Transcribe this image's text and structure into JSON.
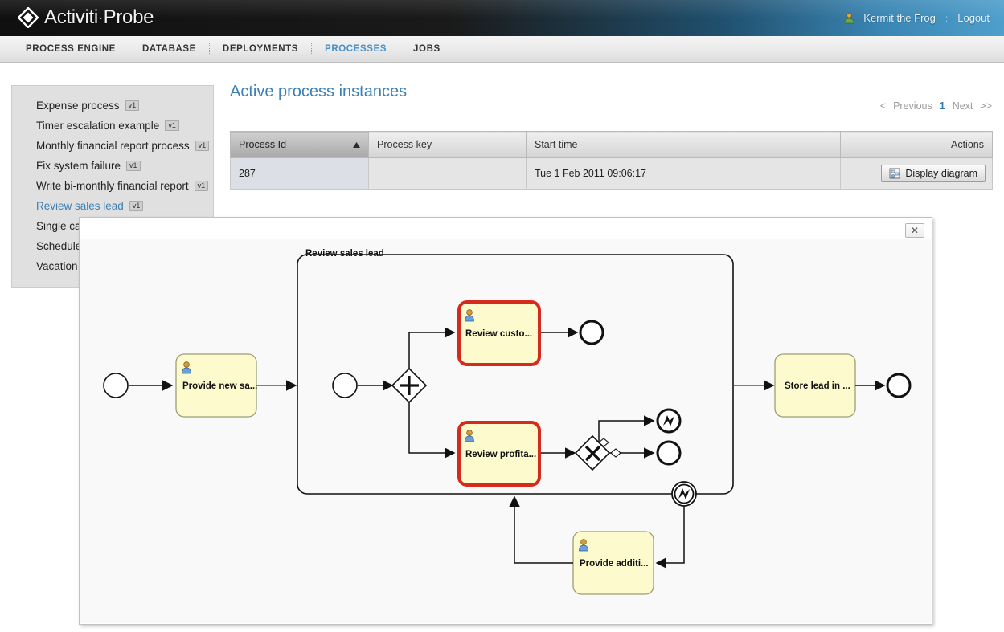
{
  "header": {
    "brand_name": "Activiti",
    "brand_sep": "·",
    "brand_name2": "Probe",
    "user_name": "Kermit the Frog",
    "logout_label": "Logout",
    "divider": ":",
    "user_icon": "user-icon",
    "logo_icon": "diamond-logo-icon"
  },
  "nav": {
    "items": [
      {
        "label": "PROCESS ENGINE",
        "active": false
      },
      {
        "label": "DATABASE",
        "active": false
      },
      {
        "label": "DEPLOYMENTS",
        "active": false
      },
      {
        "label": "PROCESSES",
        "active": true
      },
      {
        "label": "JOBS",
        "active": false
      }
    ]
  },
  "sidebar": {
    "items": [
      {
        "label": "Expense process",
        "version": "v1",
        "selected": false
      },
      {
        "label": "Timer escalation example",
        "version": "v1",
        "selected": false
      },
      {
        "label": "Monthly financial report process",
        "version": "v1",
        "selected": false
      },
      {
        "label": "Fix system failure",
        "version": "v1",
        "selected": false
      },
      {
        "label": "Write bi-monthly financial report",
        "version": "v1",
        "selected": false
      },
      {
        "label": "Review sales lead",
        "version": "v1",
        "selected": true
      },
      {
        "label": "Single ca",
        "version": "",
        "selected": false
      },
      {
        "label": "Schedule",
        "version": "",
        "selected": false
      },
      {
        "label": "Vacation",
        "version": "",
        "selected": false
      }
    ]
  },
  "main": {
    "title": "Active process instances",
    "pager": {
      "prev_arrow": "<",
      "prev_label": "Previous",
      "current_page": "1",
      "next_label": "Next",
      "next_arrow": ">>"
    },
    "table": {
      "columns": [
        {
          "label": "Process Id",
          "sorted": true,
          "sort_dir": "asc"
        },
        {
          "label": "Process key",
          "sorted": false,
          "sort_dir": ""
        },
        {
          "label": "Start time",
          "sorted": false,
          "sort_dir": ""
        },
        {
          "label": "",
          "sorted": false,
          "sort_dir": ""
        },
        {
          "label": "Actions",
          "sorted": false,
          "sort_dir": ""
        }
      ],
      "rows": [
        {
          "process_id": "287",
          "process_key": "",
          "start_time": "Tue 1 Feb 2011 09:06:17",
          "action_label": "Display diagram",
          "action_icon": "diagram-icon"
        }
      ]
    }
  },
  "modal": {
    "close_label": "✕",
    "close_icon": "close-icon",
    "diagram": {
      "subprocess_label": "Review sales lead",
      "nodes": [
        {
          "id": "start",
          "type": "start-event",
          "label": ""
        },
        {
          "id": "provide_new_sales_lead",
          "type": "user-task",
          "label": "Provide new sa...",
          "active": false
        },
        {
          "id": "sub_start",
          "type": "start-event",
          "label": ""
        },
        {
          "id": "parallel_gateway",
          "type": "parallel-gateway",
          "label": ""
        },
        {
          "id": "review_customer_rating",
          "type": "user-task",
          "label": "Review custo...",
          "active": true
        },
        {
          "id": "review_customer_end",
          "type": "end-event",
          "label": ""
        },
        {
          "id": "review_profitability",
          "type": "user-task",
          "label": "Review profita...",
          "active": true
        },
        {
          "id": "exclusive_gateway",
          "type": "exclusive-gateway",
          "label": ""
        },
        {
          "id": "error_end_event",
          "type": "error-end-event",
          "label": ""
        },
        {
          "id": "profit_end_event",
          "type": "end-event",
          "label": ""
        },
        {
          "id": "boundary_error_event",
          "type": "boundary-error-event",
          "label": ""
        },
        {
          "id": "provide_additional_details",
          "type": "user-task",
          "label": "Provide additi...",
          "active": false
        },
        {
          "id": "store_lead_in_system",
          "type": "service-task",
          "label": "Store lead in ...",
          "active": false
        },
        {
          "id": "process_end",
          "type": "end-event",
          "label": ""
        }
      ]
    }
  },
  "colors": {
    "accent_blue": "#3a7fb5",
    "task_fill": "#fdfbcd",
    "task_stroke": "#b8b88a",
    "active_stroke": "#d52b1e",
    "header_blue": "#4f9fcc",
    "sidebar_bg": "#e0e0e0"
  }
}
